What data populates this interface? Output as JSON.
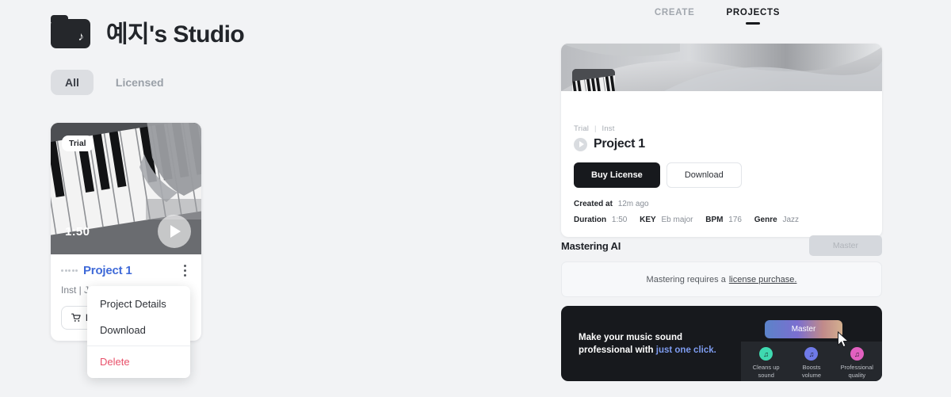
{
  "header": {
    "folder_icon": "folder-music-icon",
    "title": "예지's Studio"
  },
  "filters": [
    {
      "label": "All",
      "active": true
    },
    {
      "label": "Licensed",
      "active": false
    }
  ],
  "project_card": {
    "badge": "Trial",
    "duration": "1:50",
    "play_icon": "play-icon",
    "title": "Project 1",
    "subtitle": "Inst | J",
    "buy_label": "B",
    "cart_icon": "shopping-cart-icon",
    "kebab_icon": "kebab-menu-icon"
  },
  "context_menu": {
    "items": [
      {
        "label": "Project Details",
        "danger": false
      },
      {
        "label": "Download",
        "danger": false
      },
      {
        "label": "Delete",
        "danger": true
      }
    ]
  },
  "topnav": [
    {
      "label": "CREATE",
      "active": false
    },
    {
      "label": "PROJECTS",
      "active": true
    }
  ],
  "detail": {
    "breadcrumb_1": "Trial",
    "breadcrumb_sep": "|",
    "breadcrumb_2": "Inst",
    "title": "Project 1",
    "play_icon": "play-icon",
    "buy_license_label": "Buy License",
    "download_label": "Download",
    "created_key": "Created at",
    "created_val": "12m ago",
    "duration_key": "Duration",
    "duration_val": "1:50",
    "key_key": "KEY",
    "key_val": "Eb major",
    "bpm_key": "BPM",
    "bpm_val": "176",
    "genre_key": "Genre",
    "genre_val": "Jazz"
  },
  "mastering": {
    "title": "Mastering AI",
    "master_button": "Master",
    "notice_text": "Mastering requires a",
    "notice_link": "license purchase."
  },
  "promo": {
    "line1": "Make your music sound",
    "line2_plain": "professional with ",
    "line2_accent": "just one click.",
    "master_label": "Master",
    "cursor_icon": "mouse-cursor-icon",
    "features": [
      {
        "label_1": "Cleans up",
        "label_2": "sound",
        "color": "#3fd9b0",
        "icon": "music-note-icon"
      },
      {
        "label_1": "Boosts",
        "label_2": "volume",
        "color": "#6f7ae8",
        "icon": "music-note-icon"
      },
      {
        "label_1": "Professional",
        "label_2": "quality",
        "color": "#e260c0",
        "icon": "music-note-icon"
      }
    ]
  },
  "colors": {
    "background": "#f2f3f5",
    "ink": "#17191d",
    "link_blue": "#3f6ad8",
    "danger": "#e8506a",
    "accent_blue": "#7e9cf0"
  }
}
